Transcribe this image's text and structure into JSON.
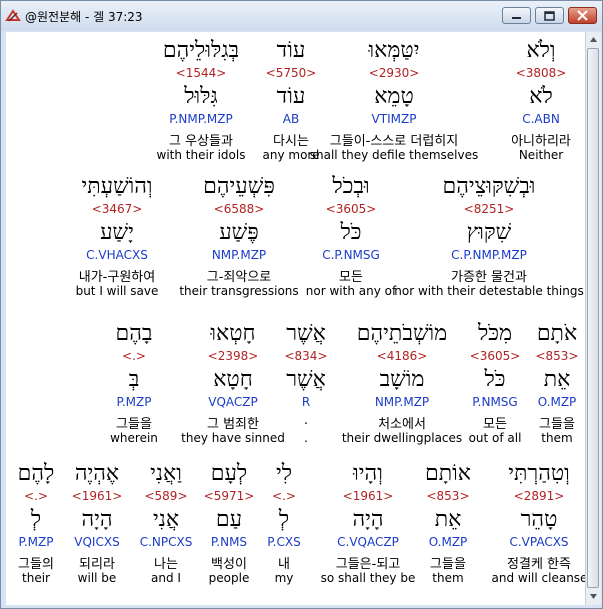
{
  "window": {
    "title": "@원전분해 - 겔 37:23"
  },
  "rows": [
    {
      "words": [
        {
          "hebrew": "וְלֹא",
          "strong": "<3808>",
          "lemma": "לֹא",
          "morph": "C.ABN",
          "korean": "아니하리라",
          "english": "Neither",
          "highlight": true
        },
        {
          "hebrew": "יִטַּמְּאוּ",
          "strong": "<2930>",
          "lemma": "טָמֵא",
          "morph": "VTIMZP",
          "korean": "그들이-스스로 더럽히지",
          "english": "shall they defile themselves"
        },
        {
          "hebrew": "עוֹד",
          "strong": "<5750>",
          "lemma": "עוֹד",
          "morph": "AB",
          "korean": "다시는",
          "english": "any more"
        },
        {
          "hebrew": "בְּגִלּוּלֵיהֶם",
          "strong": "<1544>",
          "lemma": "גִּלּוּל",
          "morph": "P.NMP.MZP",
          "korean": "그 우상들과",
          "english": "with their idols"
        }
      ]
    },
    {
      "words": [
        {
          "hebrew": "וּבְשִׁקּוּצֵיהֶם",
          "strong": "<8251>",
          "lemma": "שִׁקּוּץ",
          "morph": "C.P.NMP.MZP",
          "korean": "가증한 물건과",
          "english": "nor with their detestable things"
        },
        {
          "hebrew": "וּבְכֹל",
          "strong": "<3605>",
          "lemma": "כֹּל",
          "morph": "C.P.NMSG",
          "korean": "모든",
          "english": "nor with any of"
        },
        {
          "hebrew": "פִּשְׁעֵיהֶם",
          "strong": "<6588>",
          "lemma": "פֶּשַׁע",
          "morph": "NMP.MZP",
          "korean": "그-죄악으로",
          "english": "their transgressions"
        },
        {
          "hebrew": "וְהוֹשַׁעְתִּי",
          "strong": "<3467>",
          "lemma": "יָשַׁע",
          "morph": "C.VHACXS",
          "korean": "내가-구원하여",
          "english": "but I will save"
        }
      ]
    },
    {
      "words": [
        {
          "hebrew": "אֹתָם",
          "strong": "<853>",
          "lemma": "אֵת",
          "morph": "O.MZP",
          "korean": "그들을",
          "english": "them"
        },
        {
          "hebrew": "מִכֹּל",
          "strong": "<3605>",
          "lemma": "כֹּל",
          "morph": "P.NMSG",
          "korean": "모든",
          "english": "out of all"
        },
        {
          "hebrew": "מוֹשְׁבֹתֵיהֶם",
          "strong": "<4186>",
          "lemma": "מוֹשָׁב",
          "morph": "NMP.MZP",
          "korean": "처소에서",
          "english": "their dwellingplaces"
        },
        {
          "hebrew": "אֲשֶׁר",
          "strong": "<834>",
          "lemma": "אֲשֶׁר",
          "morph": "R",
          "korean": ".",
          "english": "."
        },
        {
          "hebrew": "חָטְאוּ",
          "strong": "<2398>",
          "lemma": "חָטָא",
          "morph": "VQACZP",
          "korean": "그 범죄한",
          "english": "they have sinned"
        },
        {
          "hebrew": "בָהֶם",
          "strong": "<.>",
          "lemma": "בְּ",
          "morph": "P.MZP",
          "korean": "그들을",
          "english": "wherein"
        }
      ]
    },
    {
      "words": [
        {
          "hebrew": "וְטִהַרְתִּי",
          "strong": "<2891>",
          "lemma": "טָהֵר",
          "morph": "C.VPACXS",
          "korean": "정결케 한즉",
          "english": "and will cleanse"
        },
        {
          "hebrew": "אוֹתָם",
          "strong": "<853>",
          "lemma": "אֵת",
          "morph": "O.MZP",
          "korean": "그들을",
          "english": "them"
        },
        {
          "hebrew": "וְהָיוּ",
          "strong": "<1961>",
          "lemma": "הָיָה",
          "morph": "C.VQACZP",
          "korean": "그들은-되고",
          "english": "so shall they be"
        },
        {
          "hebrew": "לִי",
          "strong": "<.>",
          "lemma": "לְ",
          "morph": "P.CXS",
          "korean": "내",
          "english": "my"
        },
        {
          "hebrew": "לְעָם",
          "strong": "<5971>",
          "lemma": "עַם",
          "morph": "P.NMS",
          "korean": "백성이",
          "english": "people"
        },
        {
          "hebrew": "וַאֲנִי",
          "strong": "<589>",
          "lemma": "אֲנִי",
          "morph": "C.NPCXS",
          "korean": "나는",
          "english": "and I"
        },
        {
          "hebrew": "אֶהְיֶה",
          "strong": "<1961>",
          "lemma": "הָיָה",
          "morph": "VQICXS",
          "korean": "되리라",
          "english": "will be"
        },
        {
          "hebrew": "לָהֶם",
          "strong": "<.>",
          "lemma": "לְ",
          "morph": "P.MZP",
          "korean": "그들의",
          "english": "their"
        }
      ]
    }
  ]
}
